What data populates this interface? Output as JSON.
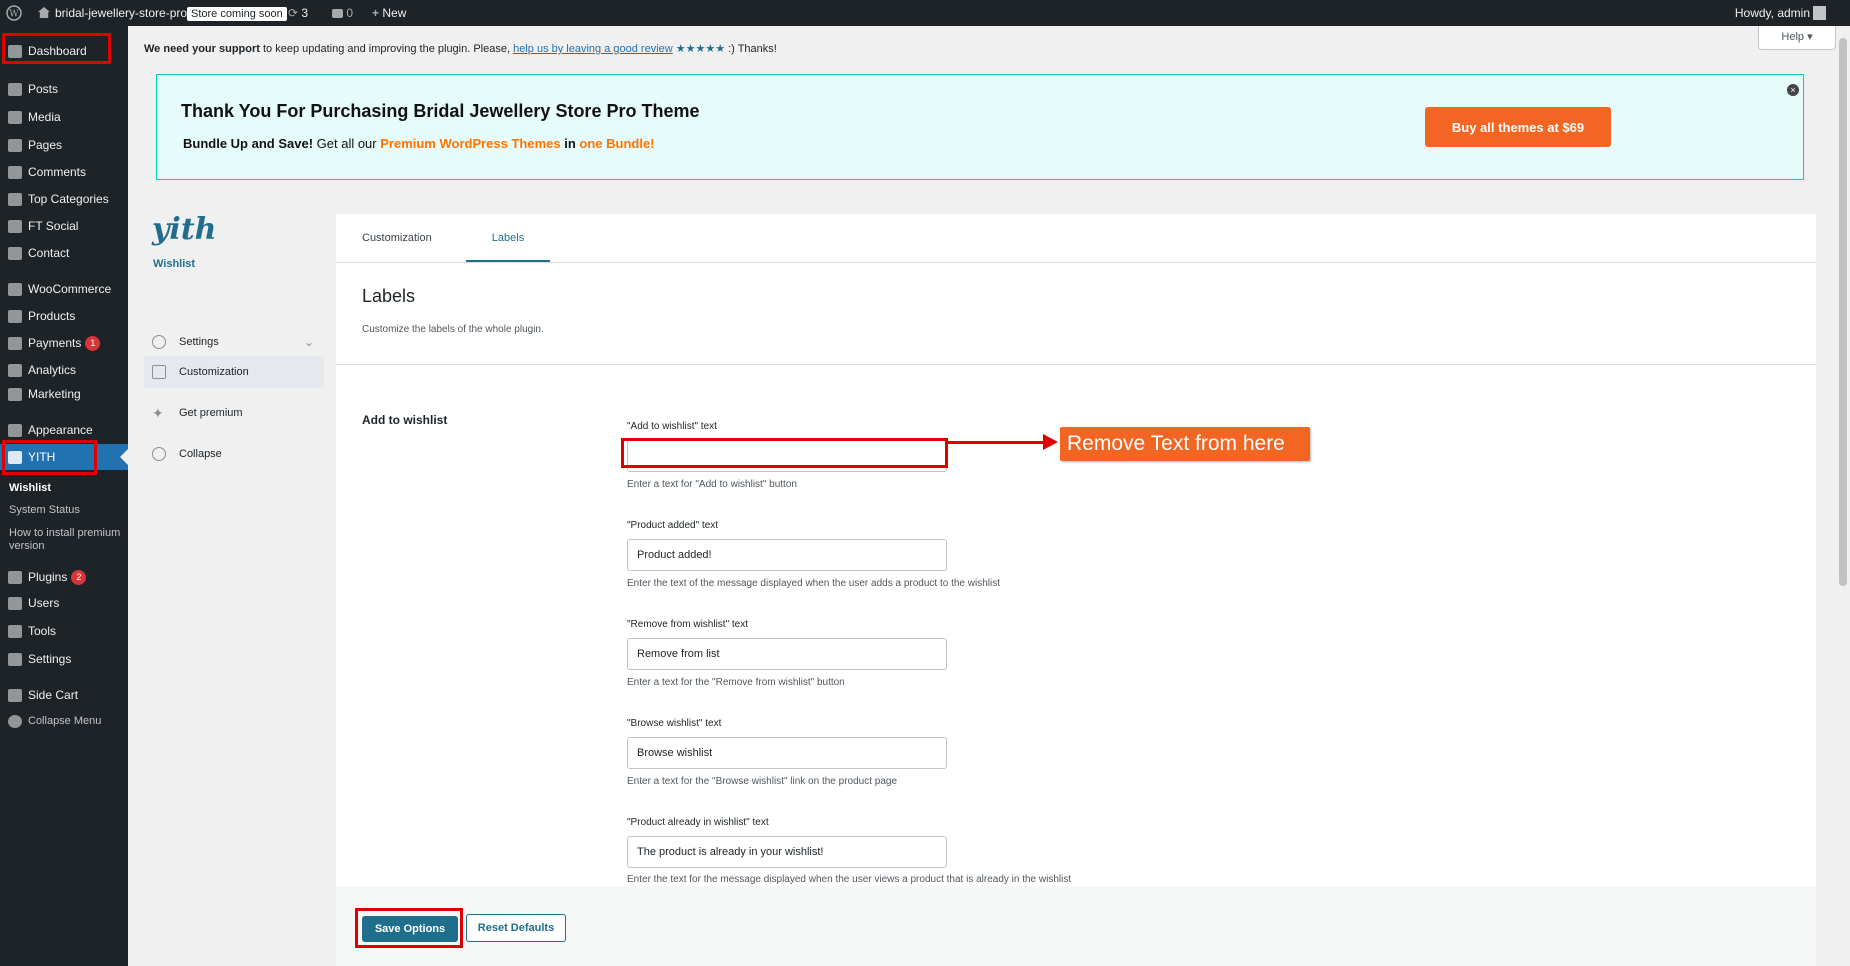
{
  "adminbar": {
    "site_name": "bridal-jewellery-store-pro",
    "store_badge": "Store coming soon",
    "updates_count": "3",
    "comments_count": "0",
    "new_label": "New",
    "howdy": "Howdy, admin"
  },
  "sidebar": {
    "items": [
      {
        "label": "Dashboard"
      },
      {
        "label": "Posts"
      },
      {
        "label": "Media"
      },
      {
        "label": "Pages"
      },
      {
        "label": "Comments"
      },
      {
        "label": "Top Categories"
      },
      {
        "label": "FT Social"
      },
      {
        "label": "Contact"
      },
      {
        "label": "WooCommerce"
      },
      {
        "label": "Products"
      },
      {
        "label": "Payments",
        "badge": "1"
      },
      {
        "label": "Analytics"
      },
      {
        "label": "Marketing"
      },
      {
        "label": "Appearance"
      },
      {
        "label": "YITH"
      },
      {
        "label": "Plugins",
        "badge": "2"
      },
      {
        "label": "Users"
      },
      {
        "label": "Tools"
      },
      {
        "label": "Settings"
      },
      {
        "label": "Side Cart"
      },
      {
        "label": "Collapse Menu"
      }
    ],
    "yith_sub": {
      "wishlist": "Wishlist",
      "system_status": "System Status",
      "how_to_line1": "How to install premium",
      "how_to_line2": "version"
    }
  },
  "notice": {
    "bold": "We need your support",
    "text": " to keep updating and improving the plugin. Please, ",
    "link": "help us by leaving a good review",
    "stars": " ★★★★★ ",
    "tail": ":) Thanks!"
  },
  "help_button": "Help ▾",
  "promo": {
    "title": "Thank You For Purchasing Bridal Jewellery Store Pro Theme",
    "bundle_bold": "Bundle Up and Save!",
    "bundle_text": " Get all our ",
    "premium_link": "Premium WordPress Themes",
    "in_text": " in ",
    "one_bundle": "one Bundle!",
    "buy_button": "Buy all themes at $69",
    "close": "×"
  },
  "yith_panel": {
    "logo": "yith",
    "logo_sub": "Wishlist",
    "nav": {
      "settings": "Settings",
      "customization": "Customization",
      "get_premium": "Get premium",
      "collapse": "Collapse"
    },
    "tabs": {
      "customization": "Customization",
      "labels": "Labels"
    },
    "title": "Labels",
    "description": "Customize the labels of the whole plugin.",
    "section": "Add to wishlist",
    "fields": [
      {
        "label": "\"Add to wishlist\" text",
        "value": "",
        "help": "Enter a text for \"Add to wishlist\" button"
      },
      {
        "label": "\"Product added\" text",
        "value": "Product added!",
        "help": "Enter the text of the message displayed when the user adds a product to the wishlist"
      },
      {
        "label": "\"Remove from wishlist\" text",
        "value": "Remove from list",
        "help": "Enter a text for the \"Remove from wishlist\" button"
      },
      {
        "label": "\"Browse wishlist\" text",
        "value": "Browse wishlist",
        "help": "Enter a text for the \"Browse wishlist\" link on the product page"
      },
      {
        "label": "\"Product already in wishlist\" text",
        "value": "The product is already in your wishlist!",
        "help": "Enter the text for the message displayed when the user views a product that is already in the wishlist"
      }
    ],
    "save_button": "Save Options",
    "reset_button": "Reset Defaults"
  },
  "annotation": {
    "callout": "Remove Text from here"
  },
  "colors": {
    "admin_dark": "#1d2327",
    "accent_blue": "#2271b1",
    "yith_blue": "#1f6e8b",
    "orange": "#f26522",
    "highlight_red": "#e00000",
    "promo_bg": "#e6fcfb"
  }
}
